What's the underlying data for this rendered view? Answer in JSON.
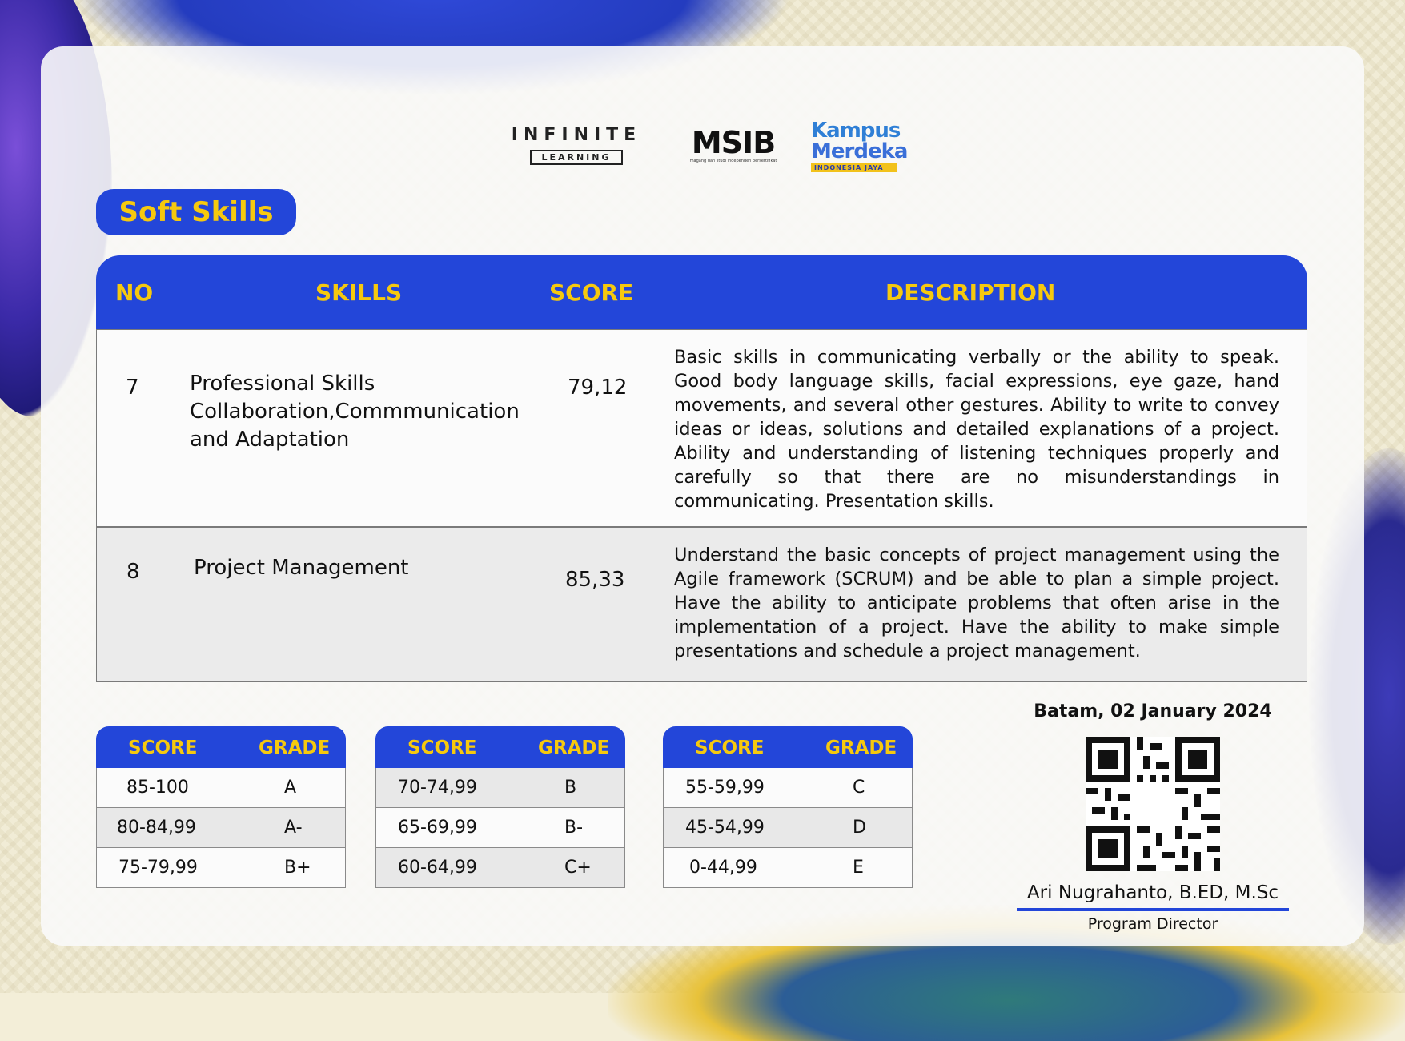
{
  "logos": {
    "infinite_word": "INFINITE",
    "infinite_sub": "LEARNING",
    "msib_word": "MSIB",
    "msib_tag": "magang dan studi independen bersertifikat",
    "kampus_line1": "Kampus",
    "kampus_line2": "Merdeka",
    "kampus_band": "INDONESIA JAYA"
  },
  "section_title": "Soft Skills",
  "table": {
    "headers": {
      "no": "NO",
      "skills": "SKILLS",
      "score": "SCORE",
      "description": "DESCRIPTION"
    },
    "rows": [
      {
        "no": "7",
        "skill_lines": [
          "Professional Skills",
          "Collaboration,Commmunication",
          "and Adaptation"
        ],
        "score": "79,12",
        "description": "Basic skills in communicating verbally or the ability to speak. Good body language skills, facial expressions, eye gaze, hand movements, and several other gestures. Ability to write to convey ideas or ideas, solutions and detailed explanations of a project. Ability and understanding of listening techniques properly and carefully so that there are no misunderstandings in communicating. Presentation skills."
      },
      {
        "no": "8",
        "skill_lines": [
          "Project Management"
        ],
        "score": "85,33",
        "description": "Understand the basic concepts of project management using the Agile framework (SCRUM) and be able to plan a simple project. Have the ability to anticipate problems that often arise in the implementation of a project. Have the ability to make simple presentations and schedule a project management."
      }
    ]
  },
  "grade_tables": [
    {
      "score_header": "SCORE",
      "grade_header": "GRADE",
      "rows": [
        {
          "score": "85-100",
          "grade": "A"
        },
        {
          "score": "80-84,99",
          "grade": "A-"
        },
        {
          "score": "75-79,99",
          "grade": "B+"
        }
      ]
    },
    {
      "score_header": "SCORE",
      "grade_header": "GRADE",
      "rows": [
        {
          "score": "70-74,99",
          "grade": "B"
        },
        {
          "score": "65-69,99",
          "grade": "B-"
        },
        {
          "score": "60-64,99",
          "grade": "C+"
        }
      ]
    },
    {
      "score_header": "SCORE",
      "grade_header": "GRADE",
      "rows": [
        {
          "score": "55-59,99",
          "grade": "C"
        },
        {
          "score": "45-54,99",
          "grade": "D"
        },
        {
          "score": "0-44,99",
          "grade": "E"
        }
      ]
    }
  ],
  "signature": {
    "place_date": "Batam, 02 January 2024",
    "name": "Ari Nugrahanto, B.ED, M.Sc",
    "role": "Program Director"
  },
  "colors": {
    "accent_blue": "#2346d9",
    "accent_yellow": "#f6c90e"
  }
}
